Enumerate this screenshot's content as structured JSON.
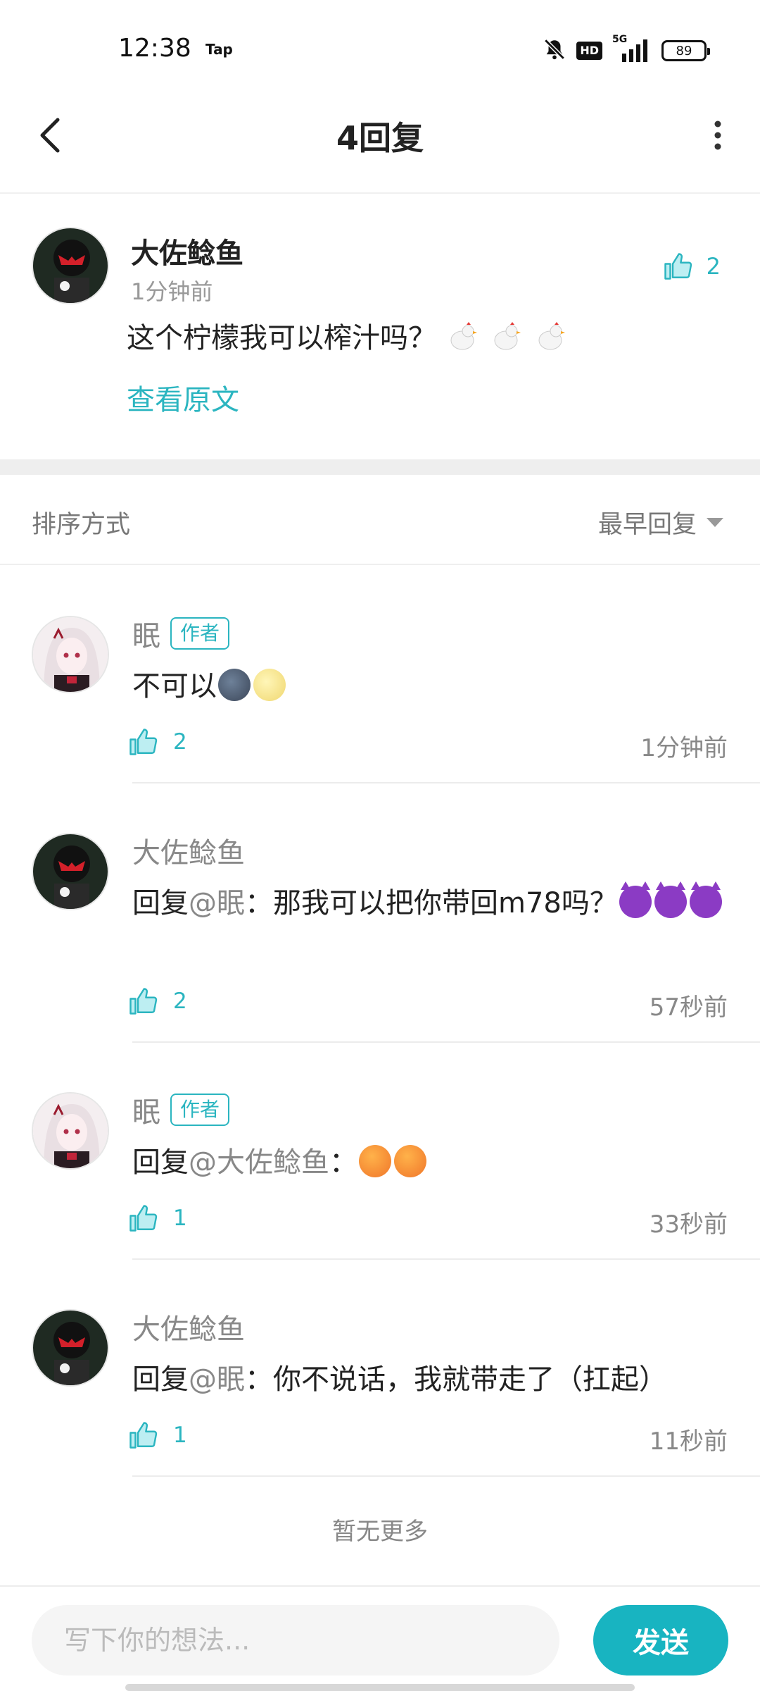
{
  "status_bar": {
    "time": "12:38",
    "app_badge": "Tap",
    "hd": "HD",
    "network": "5G",
    "battery": "89"
  },
  "header": {
    "title": "4回复",
    "back_icon": "chevron-left-icon",
    "more_icon": "more-vertical-icon"
  },
  "original_comment": {
    "author": "大佐鲶鱼",
    "time": "1分钟前",
    "text": "这个柠檬我可以榨汁吗？",
    "emojis": [
      "chicken",
      "chicken",
      "chicken"
    ],
    "view_original": "查看原文",
    "likes": "2"
  },
  "sort": {
    "label": "排序方式",
    "selected": "最早回复"
  },
  "replies": [
    {
      "author": "眠",
      "tag": "作者",
      "prefix": "",
      "mention": "",
      "content": "不可以",
      "emojis": [
        "new-moon-face",
        "full-moon-face"
      ],
      "likes": "2",
      "time": "1分钟前"
    },
    {
      "author": "大佐鲶鱼",
      "tag": "",
      "prefix": "回复",
      "mention": "@眠",
      "content": "：那我可以把你带回m78吗？",
      "emojis": [
        "smiling-devil",
        "smiling-devil",
        "smiling-devil"
      ],
      "likes": "2",
      "time": "57秒前"
    },
    {
      "author": "眠",
      "tag": "作者",
      "prefix": "回复",
      "mention": "@大佐鲶鱼",
      "content": "：",
      "emojis": [
        "angry-face",
        "angry-face"
      ],
      "likes": "1",
      "time": "33秒前"
    },
    {
      "author": "大佐鲶鱼",
      "tag": "",
      "prefix": "回复",
      "mention": "@眠",
      "content": "：你不说话，我就带走了（扛起）",
      "emojis": [],
      "likes": "1",
      "time": "11秒前"
    }
  ],
  "footer": {
    "no_more": "暂无更多",
    "input_placeholder": "写下你的想法...",
    "send": "发送"
  },
  "colors": {
    "accent": "#2bb5c0",
    "send_button": "#18b4c1",
    "muted_text": "#888888"
  }
}
